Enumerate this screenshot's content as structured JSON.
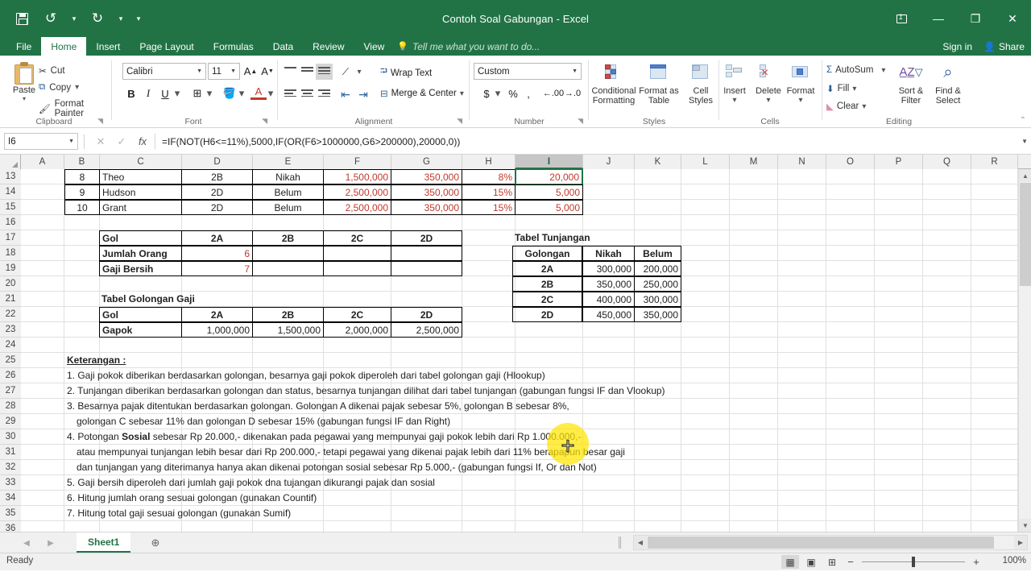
{
  "window": {
    "title": "Contoh Soal Gabungan - Excel",
    "quick_access": [
      "save-icon",
      "undo-icon",
      "redo-icon",
      "customize-icon"
    ],
    "controls": {
      "ribbon_display": "⌃",
      "minimize": "—",
      "restore": "❐",
      "close": "✕"
    }
  },
  "account": {
    "sign_in": "Sign in",
    "share": "Share"
  },
  "tabs": [
    {
      "label": "File",
      "active": false
    },
    {
      "label": "Home",
      "active": true
    },
    {
      "label": "Insert",
      "active": false
    },
    {
      "label": "Page Layout",
      "active": false
    },
    {
      "label": "Formulas",
      "active": false
    },
    {
      "label": "Data",
      "active": false
    },
    {
      "label": "Review",
      "active": false
    },
    {
      "label": "View",
      "active": false
    }
  ],
  "tell_me": "Tell me what you want to do...",
  "ribbon": {
    "clipboard": {
      "label": "Clipboard",
      "paste": "Paste",
      "cut": "Cut",
      "copy": "Copy",
      "format_painter": "Format Painter"
    },
    "font": {
      "label": "Font",
      "font_name": "Calibri",
      "font_size": "11",
      "bold": "B",
      "italic": "I",
      "underline": "U",
      "grow_font": "A",
      "shrink_font": "A"
    },
    "alignment": {
      "label": "Alignment",
      "wrap_text": "Wrap Text",
      "merge_center": "Merge & Center"
    },
    "number": {
      "label": "Number",
      "format": "Custom",
      "currency": "$",
      "percent": "%",
      "comma": ","
    },
    "styles": {
      "label": "Styles",
      "conditional_formatting": "Conditional\nFormatting",
      "conditional_formatting_l1": "Conditional",
      "conditional_formatting_l2": "Formatting",
      "format_as_table_l1": "Format as",
      "format_as_table_l2": "Table",
      "cell_styles_l1": "Cell",
      "cell_styles_l2": "Styles"
    },
    "cells": {
      "label": "Cells",
      "insert": "Insert",
      "delete": "Delete",
      "format": "Format"
    },
    "editing": {
      "label": "Editing",
      "autosum": "AutoSum",
      "fill": "Fill",
      "clear": "Clear",
      "sort_filter_l1": "Sort &",
      "sort_filter_l2": "Filter",
      "find_select_l1": "Find &",
      "find_select_l2": "Select"
    }
  },
  "formula_bar": {
    "name_box": "I6",
    "formula": "=IF(NOT(H6<=11%),5000,IF(OR(F6>1000000,G6>200000),20000,0))",
    "cancel": "✕",
    "enter": "✓",
    "insert_function": "fx"
  },
  "grid": {
    "columns": [
      "A",
      "B",
      "C",
      "D",
      "E",
      "F",
      "G",
      "H",
      "I",
      "J",
      "K",
      "L",
      "M",
      "N",
      "O",
      "P",
      "Q",
      "R"
    ],
    "selected_column": "I",
    "rows": [
      13,
      14,
      15,
      16,
      17,
      18,
      19,
      20,
      21,
      22,
      23,
      24,
      25,
      26,
      27,
      28,
      29,
      30,
      31,
      32,
      33,
      34,
      35,
      36
    ],
    "employee_rows": [
      {
        "no": "8",
        "nama": "Theo",
        "gol": "2B",
        "status": "Nikah",
        "gapok": "1,500,000",
        "tunjangan": "350,000",
        "pajak": "8%",
        "sosial": "20,000"
      },
      {
        "no": "9",
        "nama": "Hudson",
        "gol": "2D",
        "status": "Belum",
        "gapok": "2,500,000",
        "tunjangan": "350,000",
        "pajak": "15%",
        "sosial": "5,000"
      },
      {
        "no": "10",
        "nama": "Grant",
        "gol": "2D",
        "status": "Belum",
        "gapok": "2,500,000",
        "tunjangan": "350,000",
        "pajak": "15%",
        "sosial": "5,000"
      }
    ],
    "summary_table": {
      "header_label": "Gol",
      "gol_values": [
        "2A",
        "2B",
        "2C",
        "2D"
      ],
      "rows": [
        {
          "label": "Jumlah Orang",
          "values": [
            "6",
            "",
            "",
            ""
          ]
        },
        {
          "label": "Gaji Bersih",
          "values": [
            "7",
            "",
            "",
            ""
          ]
        }
      ]
    },
    "tabel_golongan_gaji": {
      "title": "Tabel Golongan Gaji",
      "header_label": "Gol",
      "gol_values": [
        "2A",
        "2B",
        "2C",
        "2D"
      ],
      "row_label": "Gapok",
      "gapok_values": [
        "1,000,000",
        "1,500,000",
        "2,000,000",
        "2,500,000"
      ]
    },
    "tabel_tunjangan": {
      "title": "Tabel Tunjangan",
      "headers": [
        "Golongan",
        "Nikah",
        "Belum"
      ],
      "rows": [
        [
          "2A",
          "300,000",
          "200,000"
        ],
        [
          "2B",
          "350,000",
          "250,000"
        ],
        [
          "2C",
          "400,000",
          "300,000"
        ],
        [
          "2D",
          "450,000",
          "350,000"
        ]
      ]
    },
    "keterangan": {
      "title": "Keterangan :",
      "lines": [
        "1. Gaji pokok diberikan berdasarkan golongan, besarnya gaji pokok diperoleh dari tabel golongan gaji (Hlookup)",
        "2. Tunjangan diberikan berdasarkan golongan dan status, besarnya tunjangan dilihat dari tabel tunjangan (gabungan fungsi IF dan Vlookup)",
        "3. Besarnya pajak ditentukan berdasarkan golongan. Golongan A dikenai pajak sebesar 5%, golongan B sebesar 8%,",
        "golongan C sebesar 11% dan golongan D sebesar 15% (gabungan fungsi IF dan Right)",
        "4. Potongan Sosial sebesar Rp 20.000,- dikenakan pada pegawai yang mempunyai gaji pokok lebih dari Rp 1.000.000,-",
        "atau mempunyai tunjangan lebih besar dari Rp 200.000,- tetapi pegawai yang dikenai pajak lebih dari 11% berapapun besar gaji",
        "dan tunjangan yang diterimanya hanya akan dikenai potongan sosial sebesar Rp 5.000,- (gabungan fungsi If, Or dan Not)",
        "5. Gaji bersih diperoleh dari jumlah gaji pokok dna tujangan dikurangi pajak dan sosial",
        "6. Hitung jumlah orang sesuai golongan (gunakan Countif)",
        "7. Hitung total gaji sesuai golongan (gunakan Sumif)"
      ],
      "line4_bold_word": "Sosial",
      "line4_pre": "4. Potongan ",
      "line4_post": " sebesar Rp 20.000,- dikenakan pada pegawai yang mempunyai gaji pokok lebih dari Rp 1.000.000,-"
    }
  },
  "sheet_tabs": {
    "tabs": [
      "Sheet1"
    ],
    "active": "Sheet1",
    "add_label": "⊕"
  },
  "status_bar": {
    "status": "Ready",
    "zoom_level": "100%",
    "views": [
      "normal-view",
      "page-layout-view",
      "page-break-view"
    ],
    "zoom_out": "−",
    "zoom_in": "+"
  },
  "colors": {
    "accent": "#217346",
    "negative": "#c0392b",
    "highlight": "#ffe500"
  }
}
